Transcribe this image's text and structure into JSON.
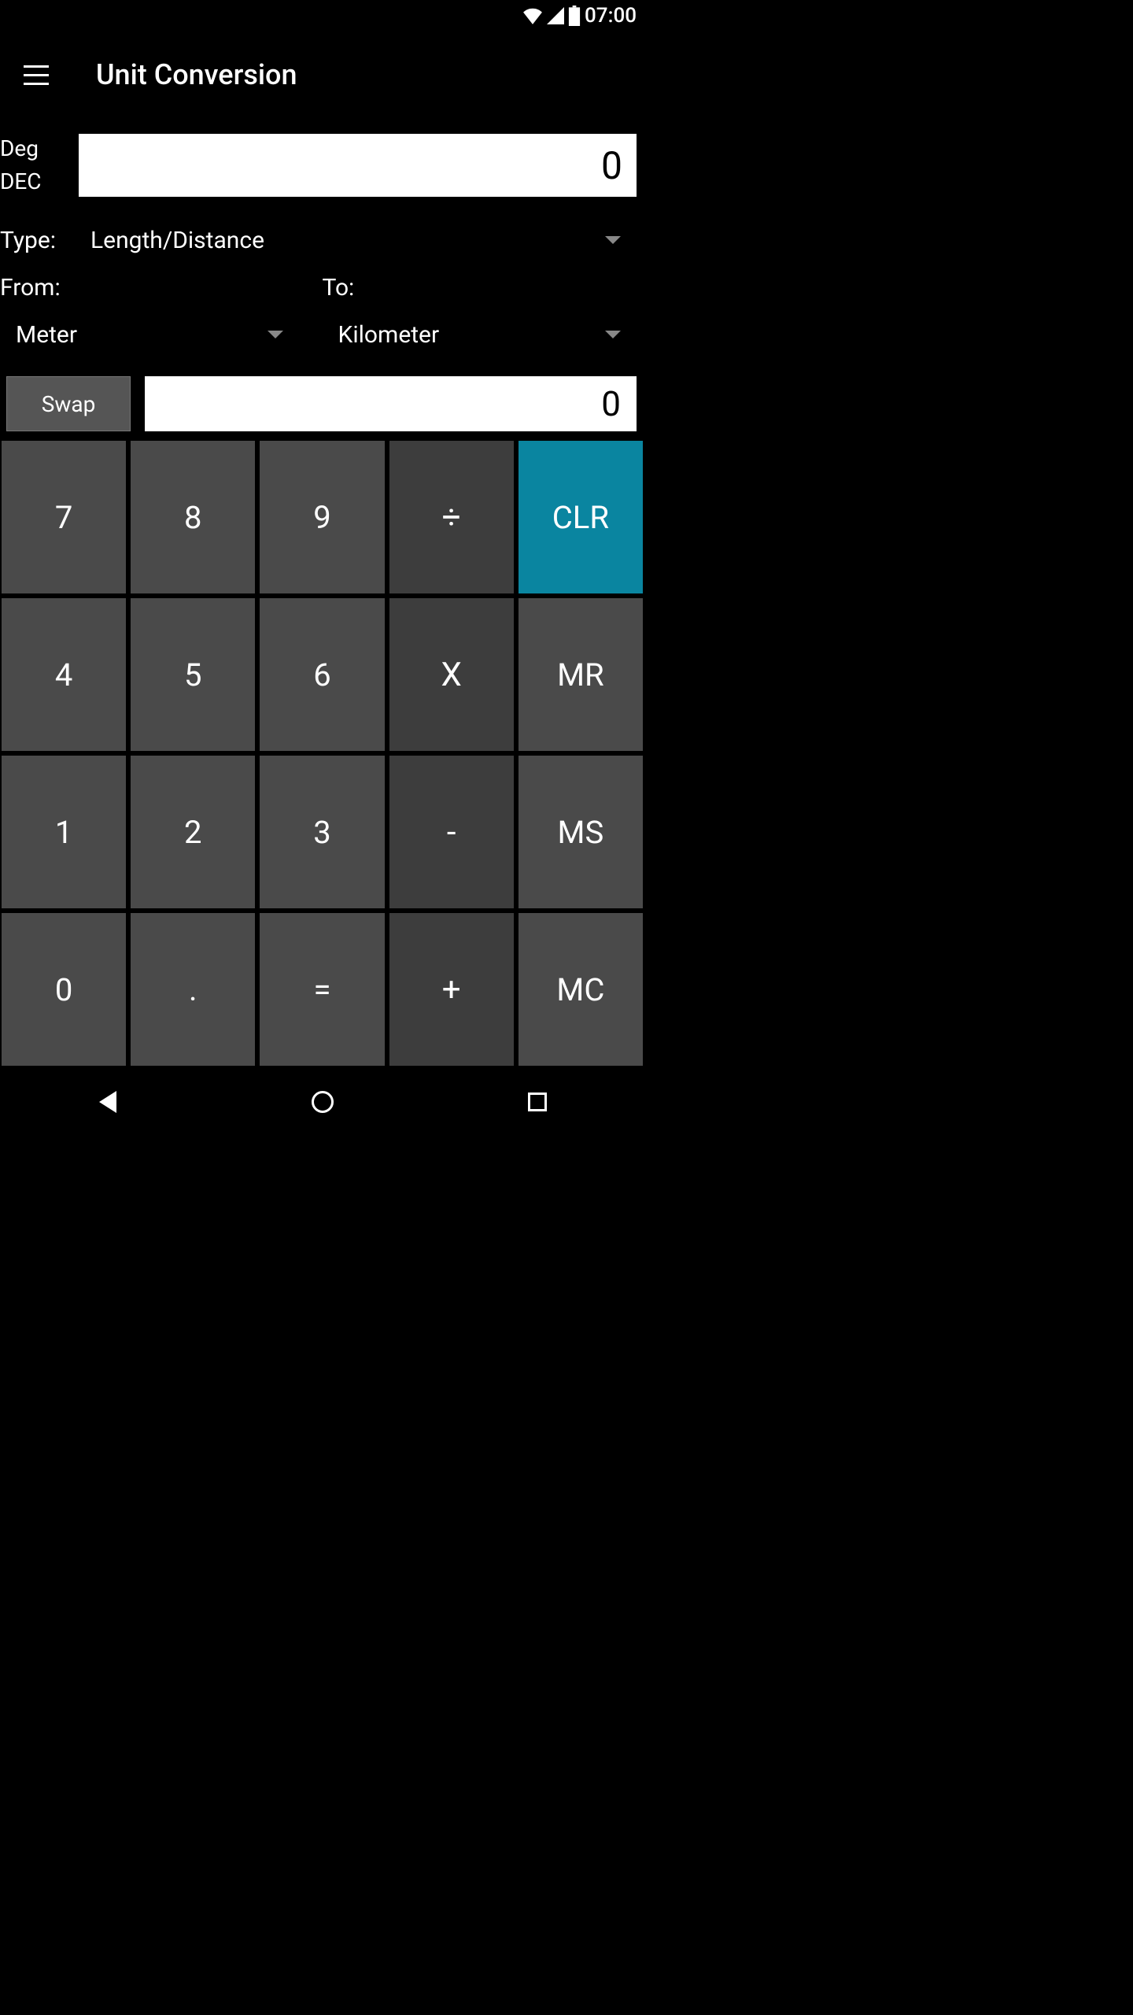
{
  "status": {
    "time": "07:00"
  },
  "header": {
    "title": "Unit Conversion"
  },
  "mode": {
    "line1": "Deg",
    "line2": "DEC"
  },
  "input": {
    "value": "0"
  },
  "type": {
    "label": "Type:",
    "value": "Length/Distance"
  },
  "from": {
    "label": "From:",
    "unit": "Meter"
  },
  "to": {
    "label": "To:",
    "unit": "Kilometer"
  },
  "swap": {
    "label": "Swap"
  },
  "result": {
    "value": "0"
  },
  "keys": {
    "k7": "7",
    "k8": "8",
    "k9": "9",
    "div": "÷",
    "clr": "CLR",
    "k4": "4",
    "k5": "5",
    "k6": "6",
    "mul": "X",
    "mr": "MR",
    "k1": "1",
    "k2": "2",
    "k3": "3",
    "sub": "-",
    "ms": "MS",
    "k0": "0",
    "dot": ".",
    "eq": "=",
    "add": "+",
    "mc": "MC"
  }
}
